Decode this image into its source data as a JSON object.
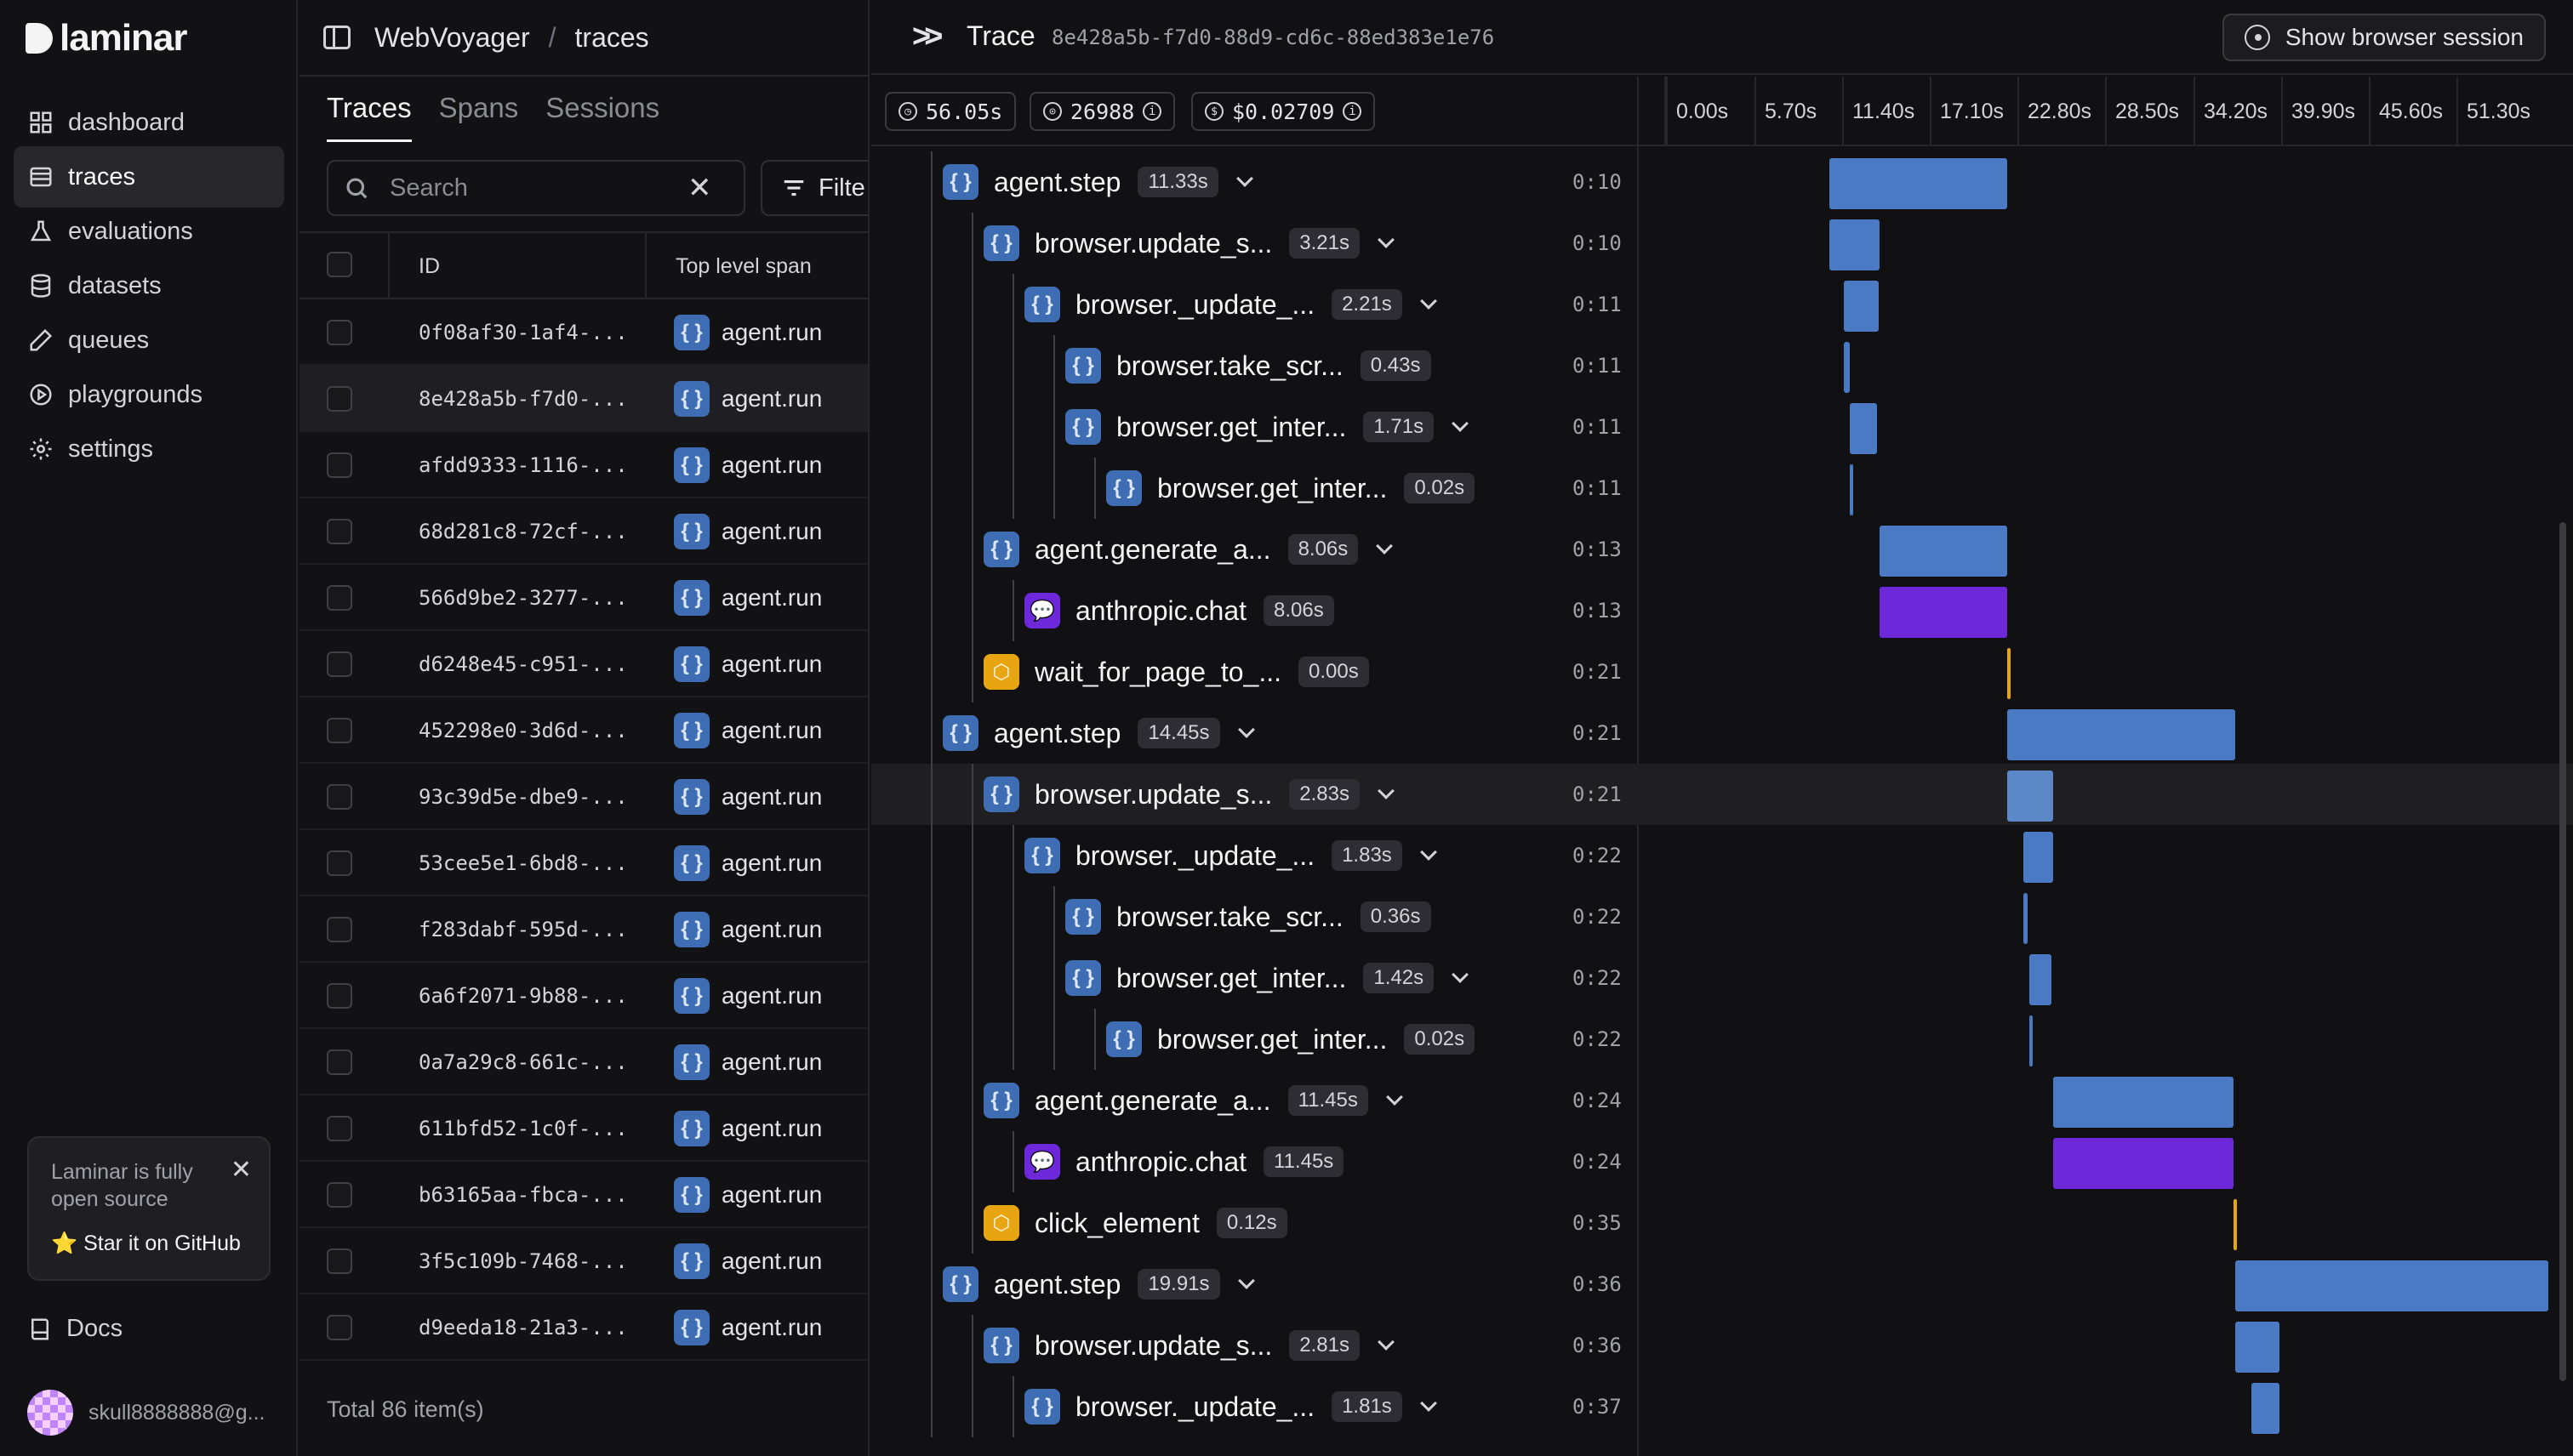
{
  "nav": {
    "logo": "laminar",
    "items": [
      {
        "label": "dashboard",
        "icon": "grid-icon"
      },
      {
        "label": "traces",
        "icon": "list-icon",
        "active": true
      },
      {
        "label": "evaluations",
        "icon": "flask-icon"
      },
      {
        "label": "datasets",
        "icon": "database-icon"
      },
      {
        "label": "queues",
        "icon": "pen-icon"
      },
      {
        "label": "playgrounds",
        "icon": "play-circle-icon"
      },
      {
        "label": "settings",
        "icon": "gear-icon"
      }
    ],
    "promo": {
      "text": "Laminar is fully open source",
      "link": "⭐ Star it on GitHub"
    },
    "docs": "Docs",
    "user": "skull8888888@g..."
  },
  "list": {
    "project": "WebVoyager",
    "page": "traces",
    "tabs": [
      "Traces",
      "Spans",
      "Sessions"
    ],
    "search_placeholder": "Search",
    "filter_label": "Filte",
    "columns": [
      "ID",
      "Top level span"
    ],
    "rows": [
      {
        "id": "0f08af30-1af4-...",
        "span": "agent.run"
      },
      {
        "id": "8e428a5b-f7d0-...",
        "span": "agent.run",
        "selected": true
      },
      {
        "id": "afdd9333-1116-...",
        "span": "agent.run"
      },
      {
        "id": "68d281c8-72cf-...",
        "span": "agent.run"
      },
      {
        "id": "566d9be2-3277-...",
        "span": "agent.run"
      },
      {
        "id": "d6248e45-c951-...",
        "span": "agent.run"
      },
      {
        "id": "452298e0-3d6d-...",
        "span": "agent.run"
      },
      {
        "id": "93c39d5e-dbe9-...",
        "span": "agent.run"
      },
      {
        "id": "53cee5e1-6bd8-...",
        "span": "agent.run"
      },
      {
        "id": "f283dabf-595d-...",
        "span": "agent.run"
      },
      {
        "id": "6a6f2071-9b88-...",
        "span": "agent.run"
      },
      {
        "id": "0a7a29c8-661c-...",
        "span": "agent.run"
      },
      {
        "id": "611bfd52-1c0f-...",
        "span": "agent.run"
      },
      {
        "id": "b63165aa-fbca-...",
        "span": "agent.run"
      },
      {
        "id": "3f5c109b-7468-...",
        "span": "agent.run"
      },
      {
        "id": "d9eeda18-21a3-...",
        "span": "agent.run"
      }
    ],
    "total": "Total 86 item(s)"
  },
  "trace": {
    "title": "Trace",
    "id": "8e428a5b-f7d0-88d9-cd6c-88ed383e1e76",
    "browser_button": "Show browser session",
    "stats": {
      "duration": "56.05s",
      "tokens": "26988",
      "cost": "$0.02709"
    },
    "ticks": [
      "0.00s",
      "5.70s",
      "11.40s",
      "17.10s",
      "22.80s",
      "28.50s",
      "34.20s",
      "39.90s",
      "45.60s",
      "51.30s"
    ],
    "spans": [
      {
        "name": "agent.step",
        "type": "def",
        "depth": 0,
        "dur": "11.33s",
        "start": "0:10",
        "caret": true,
        "b0": 10.4,
        "b1": 21.7
      },
      {
        "name": "browser.update_s...",
        "type": "def",
        "depth": 1,
        "dur": "3.21s",
        "start": "0:10",
        "caret": true,
        "b0": 10.4,
        "b1": 13.6
      },
      {
        "name": "browser._update_...",
        "type": "def",
        "depth": 2,
        "dur": "2.21s",
        "start": "0:11",
        "caret": true,
        "b0": 11.3,
        "b1": 13.5
      },
      {
        "name": "browser.take_scr...",
        "type": "def",
        "depth": 3,
        "dur": "0.43s",
        "start": "0:11",
        "caret": false,
        "b0": 11.3,
        "b1": 11.7
      },
      {
        "name": "browser.get_inter...",
        "type": "def",
        "depth": 3,
        "dur": "1.71s",
        "start": "0:11",
        "caret": true,
        "b0": 11.7,
        "b1": 13.4
      },
      {
        "name": "browser.get_inter...",
        "type": "def",
        "depth": 4,
        "dur": "0.02s",
        "start": "0:11",
        "caret": false,
        "b0": 11.7,
        "b1": 11.9
      },
      {
        "name": "agent.generate_a...",
        "type": "def",
        "depth": 1,
        "dur": "8.06s",
        "start": "0:13",
        "caret": true,
        "b0": 13.6,
        "b1": 21.7
      },
      {
        "name": "anthropic.chat",
        "type": "llm",
        "depth": 2,
        "dur": "8.06s",
        "start": "0:13",
        "caret": false,
        "b0": 13.6,
        "b1": 21.7
      },
      {
        "name": "wait_for_page_to_...",
        "type": "tool",
        "depth": 1,
        "dur": "0.00s",
        "start": "0:21",
        "caret": false,
        "b0": 21.7,
        "b1": 21.9
      },
      {
        "name": "agent.step",
        "type": "def",
        "depth": 0,
        "dur": "14.45s",
        "start": "0:21",
        "caret": true,
        "b0": 21.7,
        "b1": 36.2
      },
      {
        "name": "browser.update_s...",
        "type": "def",
        "depth": 1,
        "dur": "2.83s",
        "start": "0:21",
        "caret": true,
        "b0": 21.7,
        "b1": 24.6,
        "hl": true
      },
      {
        "name": "browser._update_...",
        "type": "def",
        "depth": 2,
        "dur": "1.83s",
        "start": "0:22",
        "caret": true,
        "b0": 22.7,
        "b1": 24.6
      },
      {
        "name": "browser.take_scr...",
        "type": "def",
        "depth": 3,
        "dur": "0.36s",
        "start": "0:22",
        "caret": false,
        "b0": 22.7,
        "b1": 23.0
      },
      {
        "name": "browser.get_inter...",
        "type": "def",
        "depth": 3,
        "dur": "1.42s",
        "start": "0:22",
        "caret": true,
        "b0": 23.1,
        "b1": 24.5
      },
      {
        "name": "browser.get_inter...",
        "type": "def",
        "depth": 4,
        "dur": "0.02s",
        "start": "0:22",
        "caret": false,
        "b0": 23.1,
        "b1": 23.3
      },
      {
        "name": "agent.generate_a...",
        "type": "def",
        "depth": 1,
        "dur": "11.45s",
        "start": "0:24",
        "caret": true,
        "b0": 24.6,
        "b1": 36.1
      },
      {
        "name": "anthropic.chat",
        "type": "llm",
        "depth": 2,
        "dur": "11.45s",
        "start": "0:24",
        "caret": false,
        "b0": 24.6,
        "b1": 36.1
      },
      {
        "name": "click_element",
        "type": "tool",
        "depth": 1,
        "dur": "0.12s",
        "start": "0:35",
        "caret": false,
        "b0": 36.1,
        "b1": 36.3
      },
      {
        "name": "agent.step",
        "type": "def",
        "depth": 0,
        "dur": "19.91s",
        "start": "0:36",
        "caret": true,
        "b0": 36.2,
        "b1": 56.1
      },
      {
        "name": "browser.update_s...",
        "type": "def",
        "depth": 1,
        "dur": "2.81s",
        "start": "0:36",
        "caret": true,
        "b0": 36.2,
        "b1": 39.0
      },
      {
        "name": "browser._update_...",
        "type": "def",
        "depth": 2,
        "dur": "1.81s",
        "start": "0:37",
        "caret": true,
        "b0": 37.2,
        "b1": 39.0
      }
    ]
  }
}
